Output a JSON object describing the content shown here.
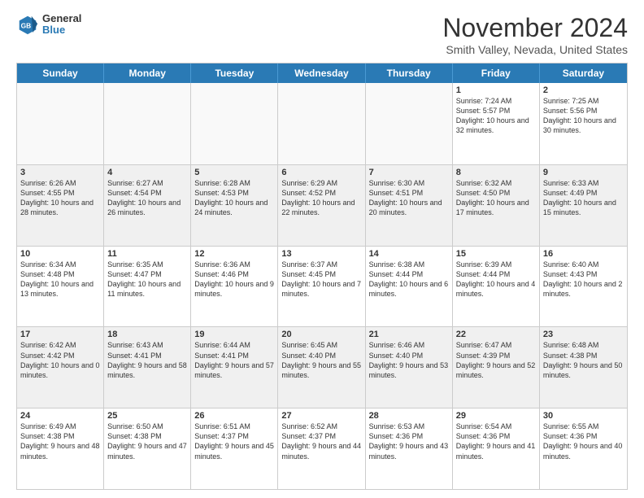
{
  "logo": {
    "general": "General",
    "blue": "Blue"
  },
  "title": "November 2024",
  "location": "Smith Valley, Nevada, United States",
  "days_of_week": [
    "Sunday",
    "Monday",
    "Tuesday",
    "Wednesday",
    "Thursday",
    "Friday",
    "Saturday"
  ],
  "weeks": [
    [
      {
        "day": "",
        "empty": true
      },
      {
        "day": "",
        "empty": true
      },
      {
        "day": "",
        "empty": true
      },
      {
        "day": "",
        "empty": true
      },
      {
        "day": "",
        "empty": true
      },
      {
        "day": "1",
        "info": "Sunrise: 7:24 AM\nSunset: 5:57 PM\nDaylight: 10 hours and 32 minutes."
      },
      {
        "day": "2",
        "info": "Sunrise: 7:25 AM\nSunset: 5:56 PM\nDaylight: 10 hours and 30 minutes."
      }
    ],
    [
      {
        "day": "3",
        "info": "Sunrise: 6:26 AM\nSunset: 4:55 PM\nDaylight: 10 hours and 28 minutes."
      },
      {
        "day": "4",
        "info": "Sunrise: 6:27 AM\nSunset: 4:54 PM\nDaylight: 10 hours and 26 minutes."
      },
      {
        "day": "5",
        "info": "Sunrise: 6:28 AM\nSunset: 4:53 PM\nDaylight: 10 hours and 24 minutes."
      },
      {
        "day": "6",
        "info": "Sunrise: 6:29 AM\nSunset: 4:52 PM\nDaylight: 10 hours and 22 minutes."
      },
      {
        "day": "7",
        "info": "Sunrise: 6:30 AM\nSunset: 4:51 PM\nDaylight: 10 hours and 20 minutes."
      },
      {
        "day": "8",
        "info": "Sunrise: 6:32 AM\nSunset: 4:50 PM\nDaylight: 10 hours and 17 minutes."
      },
      {
        "day": "9",
        "info": "Sunrise: 6:33 AM\nSunset: 4:49 PM\nDaylight: 10 hours and 15 minutes."
      }
    ],
    [
      {
        "day": "10",
        "info": "Sunrise: 6:34 AM\nSunset: 4:48 PM\nDaylight: 10 hours and 13 minutes."
      },
      {
        "day": "11",
        "info": "Sunrise: 6:35 AM\nSunset: 4:47 PM\nDaylight: 10 hours and 11 minutes."
      },
      {
        "day": "12",
        "info": "Sunrise: 6:36 AM\nSunset: 4:46 PM\nDaylight: 10 hours and 9 minutes."
      },
      {
        "day": "13",
        "info": "Sunrise: 6:37 AM\nSunset: 4:45 PM\nDaylight: 10 hours and 7 minutes."
      },
      {
        "day": "14",
        "info": "Sunrise: 6:38 AM\nSunset: 4:44 PM\nDaylight: 10 hours and 6 minutes."
      },
      {
        "day": "15",
        "info": "Sunrise: 6:39 AM\nSunset: 4:44 PM\nDaylight: 10 hours and 4 minutes."
      },
      {
        "day": "16",
        "info": "Sunrise: 6:40 AM\nSunset: 4:43 PM\nDaylight: 10 hours and 2 minutes."
      }
    ],
    [
      {
        "day": "17",
        "info": "Sunrise: 6:42 AM\nSunset: 4:42 PM\nDaylight: 10 hours and 0 minutes."
      },
      {
        "day": "18",
        "info": "Sunrise: 6:43 AM\nSunset: 4:41 PM\nDaylight: 9 hours and 58 minutes."
      },
      {
        "day": "19",
        "info": "Sunrise: 6:44 AM\nSunset: 4:41 PM\nDaylight: 9 hours and 57 minutes."
      },
      {
        "day": "20",
        "info": "Sunrise: 6:45 AM\nSunset: 4:40 PM\nDaylight: 9 hours and 55 minutes."
      },
      {
        "day": "21",
        "info": "Sunrise: 6:46 AM\nSunset: 4:40 PM\nDaylight: 9 hours and 53 minutes."
      },
      {
        "day": "22",
        "info": "Sunrise: 6:47 AM\nSunset: 4:39 PM\nDaylight: 9 hours and 52 minutes."
      },
      {
        "day": "23",
        "info": "Sunrise: 6:48 AM\nSunset: 4:38 PM\nDaylight: 9 hours and 50 minutes."
      }
    ],
    [
      {
        "day": "24",
        "info": "Sunrise: 6:49 AM\nSunset: 4:38 PM\nDaylight: 9 hours and 48 minutes."
      },
      {
        "day": "25",
        "info": "Sunrise: 6:50 AM\nSunset: 4:38 PM\nDaylight: 9 hours and 47 minutes."
      },
      {
        "day": "26",
        "info": "Sunrise: 6:51 AM\nSunset: 4:37 PM\nDaylight: 9 hours and 45 minutes."
      },
      {
        "day": "27",
        "info": "Sunrise: 6:52 AM\nSunset: 4:37 PM\nDaylight: 9 hours and 44 minutes."
      },
      {
        "day": "28",
        "info": "Sunrise: 6:53 AM\nSunset: 4:36 PM\nDaylight: 9 hours and 43 minutes."
      },
      {
        "day": "29",
        "info": "Sunrise: 6:54 AM\nSunset: 4:36 PM\nDaylight: 9 hours and 41 minutes."
      },
      {
        "day": "30",
        "info": "Sunrise: 6:55 AM\nSunset: 4:36 PM\nDaylight: 9 hours and 40 minutes."
      }
    ]
  ]
}
